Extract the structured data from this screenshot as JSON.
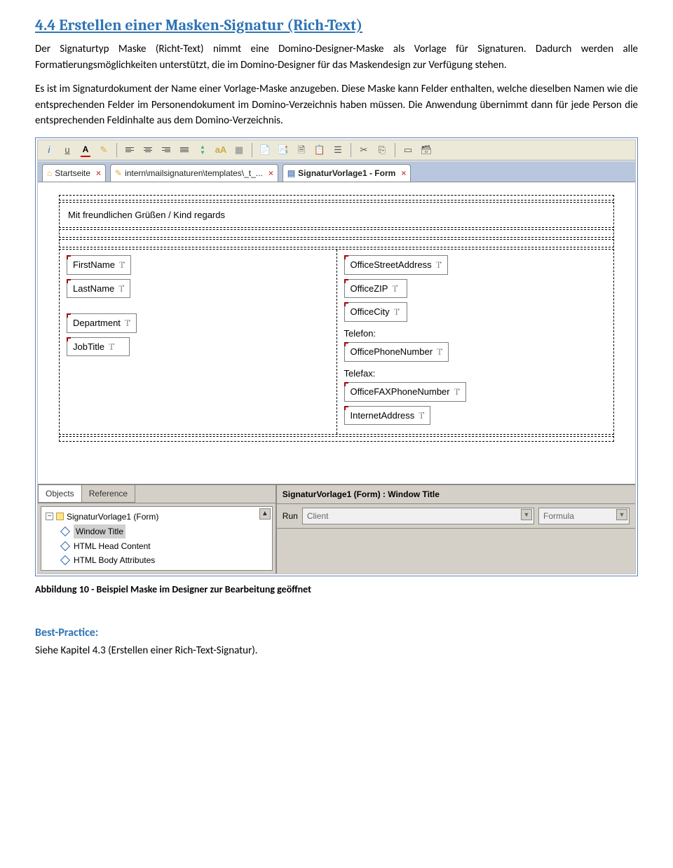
{
  "heading": "4.4  Erstellen einer Masken-Signatur (Rich-Text)",
  "para1": "Der Signaturtyp Maske (Richt-Text) nimmt eine Domino-Designer-Maske als Vorlage für Signaturen. Dadurch werden alle Formatierungsmöglichkeiten unterstützt, die im Domino-Designer für das Maskendesign zur Verfügung stehen.",
  "para2": "Es ist im Signaturdokument der Name einer Vorlage-Maske anzugeben. Diese Maske kann Felder enthalten, welche dieselben Namen wie die entsprechenden Felder im Personendokument im Domino-Verzeichnis haben müssen. Die Anwendung übernimmt dann für jede Person die entsprechenden Feldinhalte aus dem Domino-Verzeichnis.",
  "tabs": {
    "t1": "Startseite",
    "t2": "intern\\mailsignaturen\\templates\\_t_...",
    "t3": "SignaturVorlage1 - Form"
  },
  "greeting": "Mit freundlichen Grüßen / Kind regards",
  "fields_left": [
    "FirstName",
    "LastName",
    "Department",
    "JobTitle"
  ],
  "fields_right": [
    "OfficeStreetAddress",
    "OfficeZIP",
    "OfficeCity",
    "OfficePhoneNumber",
    "OfficeFAXPhoneNumber",
    "InternetAddress"
  ],
  "label_telefon": "Telefon:",
  "label_telefax": "Telefax:",
  "bottom": {
    "tab_objects": "Objects",
    "tab_reference": "Reference",
    "section_title": "SignaturVorlage1 (Form) : Window Title",
    "tree_root": "SignaturVorlage1 (Form)",
    "tree_items": [
      "Window Title",
      "HTML Head Content",
      "HTML Body Attributes"
    ],
    "run_label": "Run",
    "run_client": "Client",
    "run_formula": "Formula"
  },
  "caption": "Abbildung 10 - Beispiel Maske im Designer zur Bearbeitung geöffnet",
  "best_practice_h": "Best-Practice:",
  "best_practice_t": "Siehe Kapitel 4.3 (Erstellen einer Rich-Text-Signatur)."
}
